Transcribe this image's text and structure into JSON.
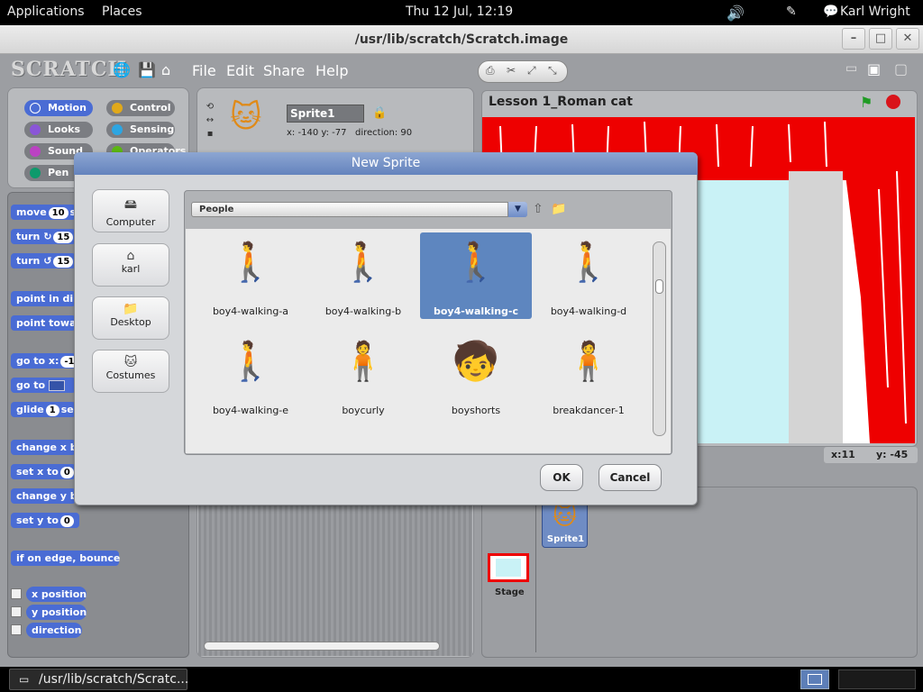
{
  "topbar": {
    "applications": "Applications",
    "places": "Places",
    "clock": "Thu 12 Jul, 12:19",
    "user": "Karl Wright"
  },
  "window": {
    "title": "/usr/lib/scratch/Scratch.image"
  },
  "scratch": {
    "logo": "SCRATCH",
    "menu": {
      "file": "File",
      "edit": "Edit",
      "share": "Share",
      "help": "Help"
    }
  },
  "categories": [
    {
      "label": "Motion",
      "color": "#4a6cd4"
    },
    {
      "label": "Control",
      "color": "#e1a91a"
    },
    {
      "label": "Looks",
      "color": "#8a55d7"
    },
    {
      "label": "Sensing",
      "color": "#2ca5e2"
    },
    {
      "label": "Sound",
      "color": "#bb42c3"
    },
    {
      "label": "Operators",
      "color": "#5cb712"
    },
    {
      "label": "Pen",
      "color": "#0e9a6c"
    }
  ],
  "blocks": {
    "move": "move",
    "move_val": "10",
    "move_tail": "s",
    "turn1": "turn",
    "turn1_val": "15",
    "turn2": "turn",
    "turn2_val": "15",
    "point_dir": "point in dir",
    "point_towards": "point towa",
    "goto_xy": "go to x:",
    "goto_xy_val": "-1",
    "goto": "go to",
    "glide": "glide",
    "glide_val": "1",
    "glide_tail": "sec",
    "change_x": "change x b",
    "set_x": "set x to",
    "set_x_val": "0",
    "change_y": "change y b",
    "set_y": "set y to",
    "set_y_val": "0",
    "bounce": "if on edge, bounce",
    "x_position": "x position",
    "y_position": "y position",
    "direction": "direction"
  },
  "sprite": {
    "name": "Sprite1",
    "x_label": "x:",
    "x": "-140",
    "y_label": "y:",
    "y": "-77",
    "direction_label": "direction:",
    "direction": "90"
  },
  "stage": {
    "title": "Lesson 1_Roman cat",
    "mouse_x_label": "x:",
    "mouse_x": "11",
    "mouse_y_label": "y:",
    "mouse_y": "-45"
  },
  "sprite_list": {
    "sprite1": "Sprite1",
    "stage": "Stage"
  },
  "dialog": {
    "title": "New Sprite",
    "locations": [
      "Computer",
      "karl",
      "Desktop",
      "Costumes"
    ],
    "folder": "People",
    "items": [
      "boy4-walking-a",
      "boy4-walking-b",
      "boy4-walking-c",
      "boy4-walking-d",
      "boy4-walking-e",
      "boycurly",
      "boyshorts",
      "breakdancer-1"
    ],
    "selected_index": 2,
    "ok": "OK",
    "cancel": "Cancel"
  },
  "taskbar": {
    "task": "/usr/lib/scratch/Scratc..."
  }
}
